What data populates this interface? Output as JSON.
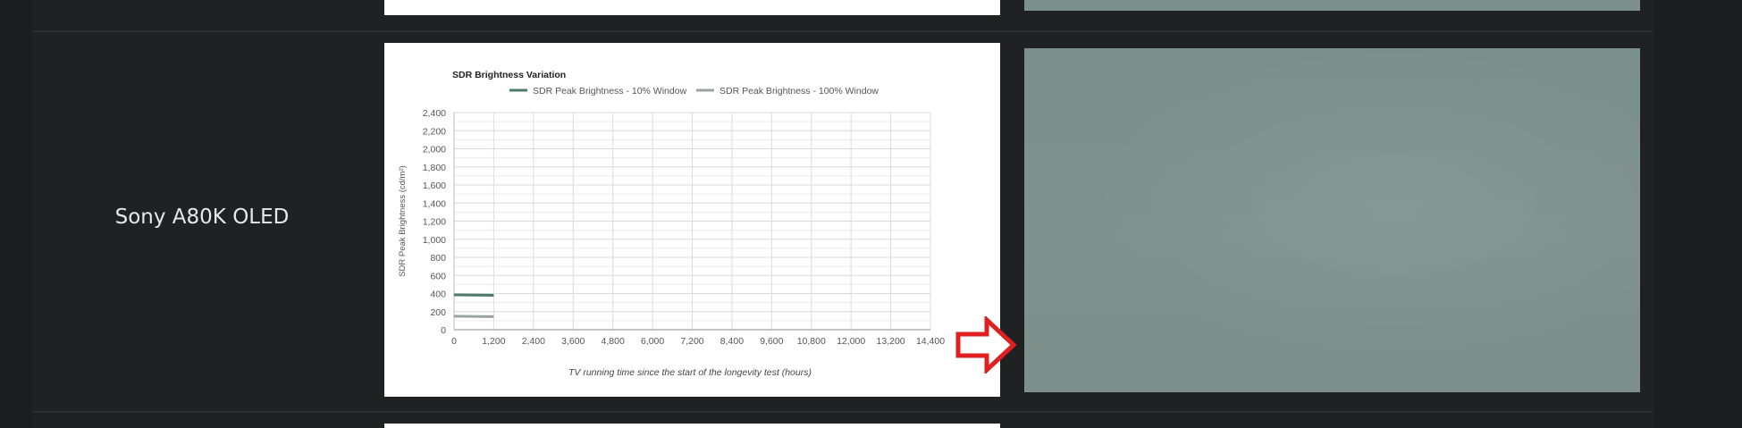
{
  "row": {
    "model_name": "Sony A80K OLED"
  },
  "chart_data": {
    "type": "line",
    "title": "SDR Brightness Variation",
    "xlabel": "TV running time since the start of the longevity test (hours)",
    "ylabel": "SDR Peak Brightness (cd/m²)",
    "xlim": [
      0,
      14400
    ],
    "ylim": [
      0,
      2400
    ],
    "x_ticks": [
      "0",
      "1,200",
      "2,400",
      "3,600",
      "4,800",
      "6,000",
      "7,200",
      "8,400",
      "9,600",
      "10,800",
      "12,000",
      "13,200",
      "14,400"
    ],
    "y_ticks": [
      "0",
      "200",
      "400",
      "600",
      "800",
      "1,000",
      "1,200",
      "1,400",
      "1,600",
      "1,800",
      "2,000",
      "2,200",
      "2,400"
    ],
    "grid": true,
    "legend": "top",
    "series": [
      {
        "name": "SDR Peak Brightness - 10% Window",
        "color": "#4f7a6e",
        "x": [
          0,
          1200
        ],
        "values": [
          385,
          380
        ]
      },
      {
        "name": "SDR Peak Brightness - 100% Window",
        "color": "#9aa3a0",
        "x": [
          0,
          1200
        ],
        "values": [
          150,
          145
        ]
      }
    ]
  },
  "colors": {
    "page_bg": "#202123",
    "photo_tint": "#7c8f8b",
    "arrow": "#e02020"
  },
  "icons": {
    "arrow": "right-arrow-icon"
  }
}
